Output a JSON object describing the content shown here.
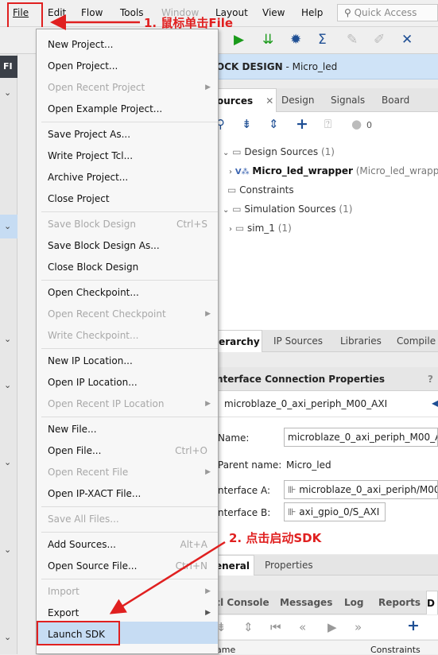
{
  "menubar": {
    "items": [
      "File",
      "Edit",
      "Flow",
      "Tools",
      "Window",
      "Layout",
      "View",
      "Help"
    ],
    "search_placeholder": "Quick Access"
  },
  "annotations": {
    "step1": "1. 鼠标单击File",
    "step2": "2. 点击启动SDK"
  },
  "block_design": {
    "prefix": "OCK DESIGN",
    "name": " - Micro_led"
  },
  "left_strip": {
    "tab": "FI"
  },
  "sources": {
    "tabs": [
      "ources",
      "Design",
      "Signals",
      "Board"
    ],
    "count": "0",
    "tree": {
      "design_sources": "Design Sources",
      "design_sources_count": "(1)",
      "wrapper": "Micro_led_wrapper",
      "wrapper_desc": "(Micro_led_wrappe",
      "constraints": "Constraints",
      "sim_sources": "Simulation Sources",
      "sim_sources_count": "(1)",
      "sim_1": "sim_1",
      "sim_1_count": "(1)"
    },
    "bottom_tabs": [
      "ierarchy",
      "IP Sources",
      "Libraries",
      "Compile O"
    ]
  },
  "properties": {
    "title": "nterface Connection Properties",
    "help": "?",
    "object": "microblaze_0_axi_periph_M00_AXI",
    "name_label": "Name:",
    "name_value": "microblaze_0_axi_periph_M00_AXI",
    "parent_label": "Parent name:",
    "parent_value": "Micro_led",
    "ifa_label": "nterface A:",
    "ifa_value": "microblaze_0_axi_periph/M00_",
    "ifb_label": "nterface B:",
    "ifb_value": "axi_gpio_0/S_AXI",
    "tabs": [
      "eneral",
      "Properties"
    ]
  },
  "console": {
    "tabs": [
      "cl Console",
      "Messages",
      "Log",
      "Reports",
      "D"
    ],
    "col_name": "ame",
    "col_constraints": "Constraints"
  },
  "file_menu": {
    "items": [
      {
        "label": "New Project...",
        "enabled": true
      },
      {
        "label": "Open Project...",
        "enabled": true
      },
      {
        "label": "Open Recent Project",
        "enabled": false,
        "submenu": true
      },
      {
        "label": "Open Example Project...",
        "enabled": true
      },
      {
        "label": "Save Project As...",
        "enabled": true
      },
      {
        "label": "Write Project Tcl...",
        "enabled": true
      },
      {
        "label": "Archive Project...",
        "enabled": true
      },
      {
        "label": "Close Project",
        "enabled": true
      },
      {
        "label": "Save Block Design",
        "enabled": false,
        "shortcut": "Ctrl+S"
      },
      {
        "label": "Save Block Design As...",
        "enabled": true
      },
      {
        "label": "Close Block Design",
        "enabled": true
      },
      {
        "label": "Open Checkpoint...",
        "enabled": true
      },
      {
        "label": "Open Recent Checkpoint",
        "enabled": false,
        "submenu": true
      },
      {
        "label": "Write Checkpoint...",
        "enabled": false
      },
      {
        "label": "New IP Location...",
        "enabled": true
      },
      {
        "label": "Open IP Location...",
        "enabled": true
      },
      {
        "label": "Open Recent IP Location",
        "enabled": false,
        "submenu": true
      },
      {
        "label": "New File...",
        "enabled": true
      },
      {
        "label": "Open File...",
        "enabled": true,
        "shortcut": "Ctrl+O"
      },
      {
        "label": "Open Recent File",
        "enabled": false,
        "submenu": true
      },
      {
        "label": "Open IP-XACT File...",
        "enabled": true
      },
      {
        "label": "Save All Files...",
        "enabled": false
      },
      {
        "label": "Add Sources...",
        "enabled": true,
        "shortcut": "Alt+A"
      },
      {
        "label": "Open Source File...",
        "enabled": true,
        "shortcut": "Ctrl+N"
      },
      {
        "label": "Import",
        "enabled": false,
        "submenu": true
      },
      {
        "label": "Export",
        "enabled": true,
        "submenu": true
      },
      {
        "label": "Launch SDK",
        "enabled": true,
        "highlighted": true
      }
    ]
  },
  "colors": {
    "accent": "#e02020",
    "highlight": "#c6dcf3",
    "header": "#cfe3f7"
  }
}
